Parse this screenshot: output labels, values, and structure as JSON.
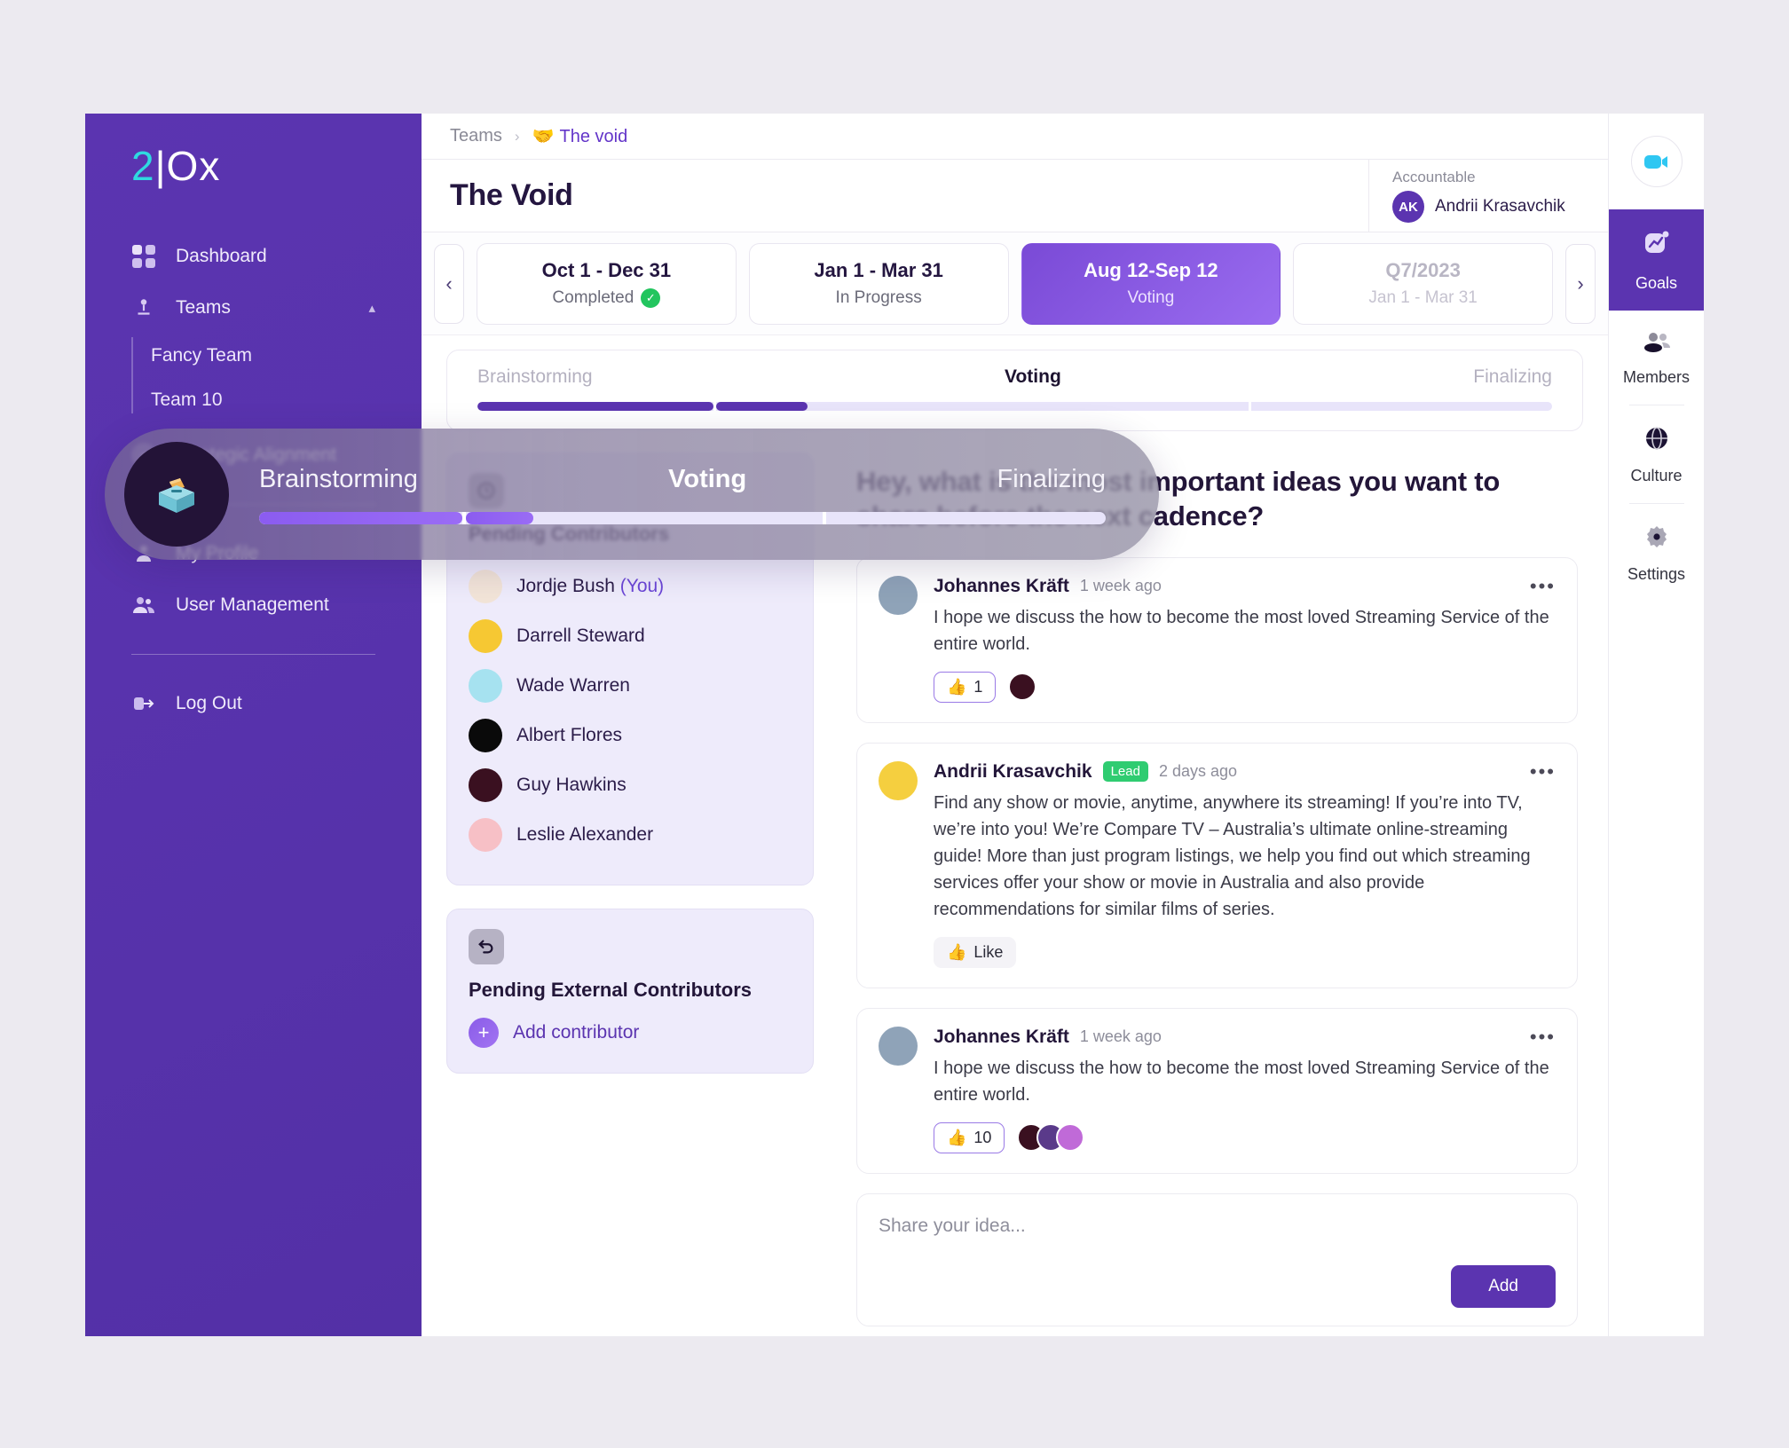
{
  "brand": {
    "logo_2": "2",
    "logo_bar": "|",
    "logo_o": "O",
    "logo_x": "x",
    "accent": "#2fd9e0",
    "primary": "#5b34b0"
  },
  "sidebar": {
    "items": [
      {
        "label": "Dashboard",
        "icon": "grid-icon"
      },
      {
        "label": "Teams",
        "icon": "team-icon",
        "chevron": "▴"
      }
    ],
    "teams": [
      {
        "label": "Fancy Team"
      },
      {
        "label": "Team 10"
      }
    ],
    "strategic": {
      "label": "Strategic Alignment",
      "icon": "compass-icon"
    },
    "account": [
      {
        "label": "My Profile",
        "icon": "user-icon"
      },
      {
        "label": "User Management",
        "icon": "users-icon"
      }
    ],
    "logout": {
      "label": "Log Out",
      "icon": "logout-icon"
    }
  },
  "breadcrumb": {
    "root": "Teams",
    "separator": "›",
    "current": "The void",
    "emoji": "🤝"
  },
  "header": {
    "title": "The Void",
    "accountable_label": "Accountable",
    "accountable_initials": "AK",
    "accountable_name": "Andrii Krasavchik",
    "camera_icon": "video-camera-icon"
  },
  "timeline": {
    "prev_icon": "‹",
    "next_icon": "›",
    "cards": [
      {
        "range": "Oct 1 - Dec 31",
        "status": "Completed",
        "state": "completed",
        "check": "✓"
      },
      {
        "range": "Jan 1 - Mar 31",
        "status": "In Progress",
        "state": "progress"
      },
      {
        "range": "Aug 12-Sep 12",
        "status": "Voting",
        "state": "active"
      },
      {
        "range": "Q7/2023",
        "status": "Jan 1 - Mar 31",
        "state": "muted"
      }
    ]
  },
  "phases": {
    "tabs": [
      {
        "label": "Brainstorming",
        "active": false
      },
      {
        "label": "Voting",
        "active": true
      },
      {
        "label": "Finalizing",
        "active": false
      }
    ],
    "progress_percent": 33,
    "segment_percent": 50
  },
  "overlay": {
    "icon": "ballot-box-icon",
    "tabs": [
      {
        "label": "Brainstorming",
        "active": false
      },
      {
        "label": "Voting",
        "active": true
      },
      {
        "label": "Finalizing",
        "active": false
      }
    ],
    "progress_percent": 33,
    "segment_percent": 50
  },
  "pending_contributors": {
    "icon": "clock-icon",
    "title": "Pending Contributors",
    "people": [
      {
        "name": "Jordje Bush",
        "suffix": " (You)",
        "color": "#f2e4d8"
      },
      {
        "name": "Darrell Steward",
        "suffix": "",
        "color": "#f6c833"
      },
      {
        "name": "Wade Warren",
        "suffix": "",
        "color": "#a6e2f0"
      },
      {
        "name": "Albert Flores",
        "suffix": "",
        "color": "#0a0a0a"
      },
      {
        "name": "Guy Hawkins",
        "suffix": "",
        "color": "#3a1020"
      },
      {
        "name": "Leslie Alexander",
        "suffix": "",
        "color": "#f7c0c6"
      }
    ]
  },
  "external_contributors": {
    "icon": "undo-icon",
    "title": "Pending External Contributors",
    "add_label": "Add contributor",
    "plus": "+"
  },
  "question": "Hey, what is the most important ideas you want to share before the next cadence?",
  "ideas": [
    {
      "author": "Johannes Kräft",
      "badge": "",
      "time": "1 week ago",
      "text": "I hope we discuss the how to become the most loved Streaming Service of the entire world.",
      "reaction_emoji": "👍",
      "reaction_count": "1",
      "reaction_style": "outlined",
      "avatar_color": "#8fa3b8",
      "reactors": [
        "#3a1020"
      ],
      "menu": "•••"
    },
    {
      "author": "Andrii Krasavchik",
      "badge": "Lead",
      "time": "2 days ago",
      "text": "Find any show or movie, anytime, anywhere its streaming! If you’re into TV, we’re into you! We’re Compare TV – Australia’s ultimate online-streaming guide! More than just program listings, we help you find out which streaming services offer your show or movie in Australia and also provide recommendations for similar films of series.",
      "reaction_emoji": "👍",
      "reaction_count": "Like",
      "reaction_style": "plain",
      "avatar_color": "#f5cf3f",
      "reactors": [],
      "menu": "•••"
    },
    {
      "author": "Johannes Kräft",
      "badge": "",
      "time": "1 week ago",
      "text": "I hope we discuss the how to become the most loved Streaming Service of the entire world.",
      "reaction_emoji": "👍",
      "reaction_count": "10",
      "reaction_style": "outlined",
      "avatar_color": "#8fa3b8",
      "reactors": [
        "#3a1020",
        "#5a3a8a",
        "#c06ad8"
      ],
      "menu": "•••"
    }
  ],
  "composer": {
    "placeholder": "Share your idea...",
    "add_label": "Add"
  },
  "rail": {
    "items": [
      {
        "label": "Goals",
        "icon": "chart-icon",
        "active": true
      },
      {
        "label": "Members",
        "icon": "members-icon",
        "active": false
      },
      {
        "label": "Culture",
        "icon": "globe-icon",
        "active": false
      },
      {
        "label": "Settings",
        "icon": "gear-icon",
        "active": false
      }
    ]
  }
}
